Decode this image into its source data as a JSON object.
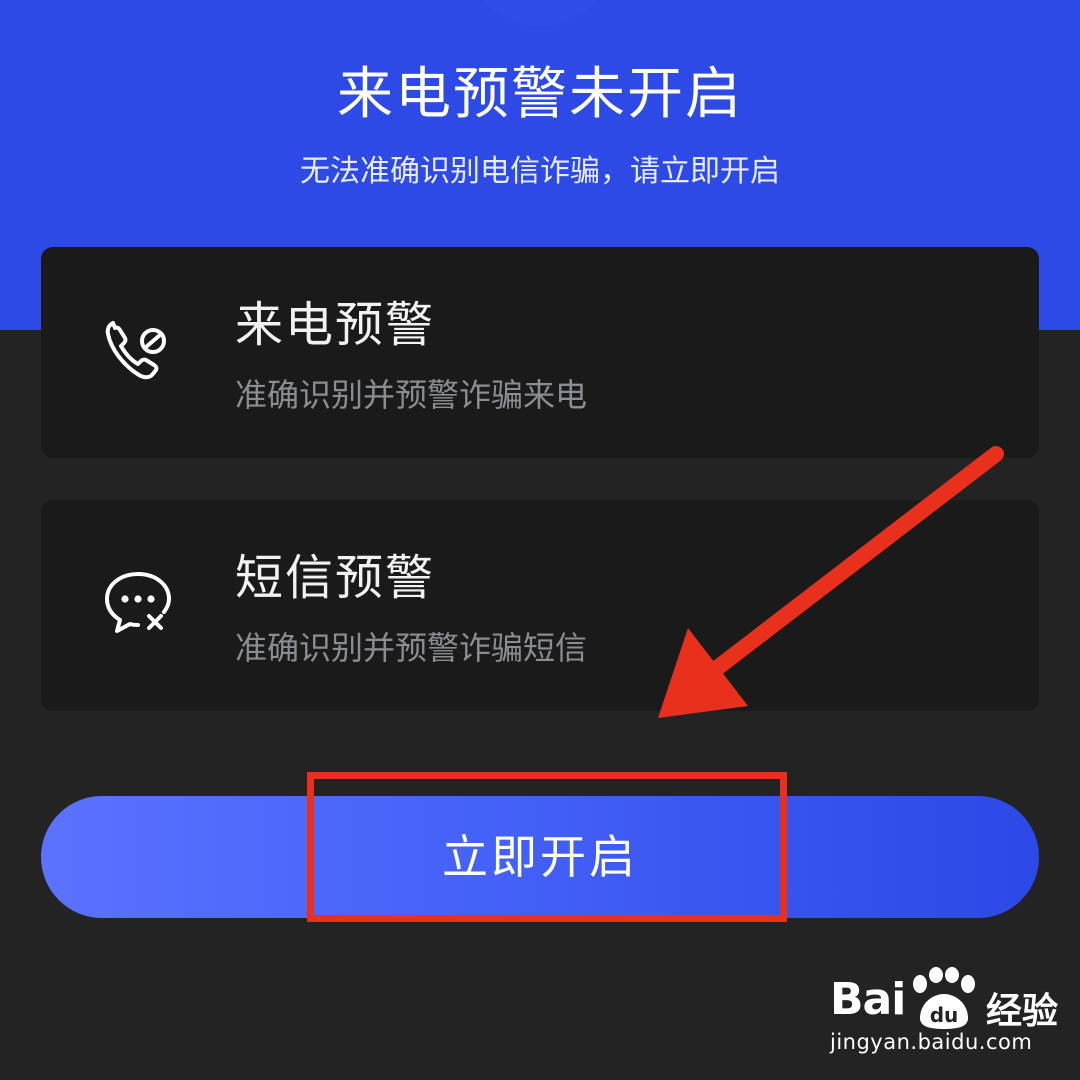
{
  "header": {
    "title": "来电预警未开启",
    "subtitle": "无法准确识别电信诈骗，请立即开启"
  },
  "features": [
    {
      "icon": "phone-block-icon",
      "title": "来电预警",
      "description": "准确识别并预警诈骗来电"
    },
    {
      "icon": "message-block-icon",
      "title": "短信预警",
      "description": "准确识别并预警诈骗短信"
    }
  ],
  "action": {
    "enable_label": "立即开启"
  },
  "watermark": {
    "brand": "Bai",
    "brand_du": "du",
    "product": "经验",
    "url": "jingyan.baidu.com"
  },
  "colors": {
    "hero_blue": "#2e4ae6",
    "background": "#232323",
    "card": "#1a1a1a",
    "annotation_red": "#e8301c"
  }
}
